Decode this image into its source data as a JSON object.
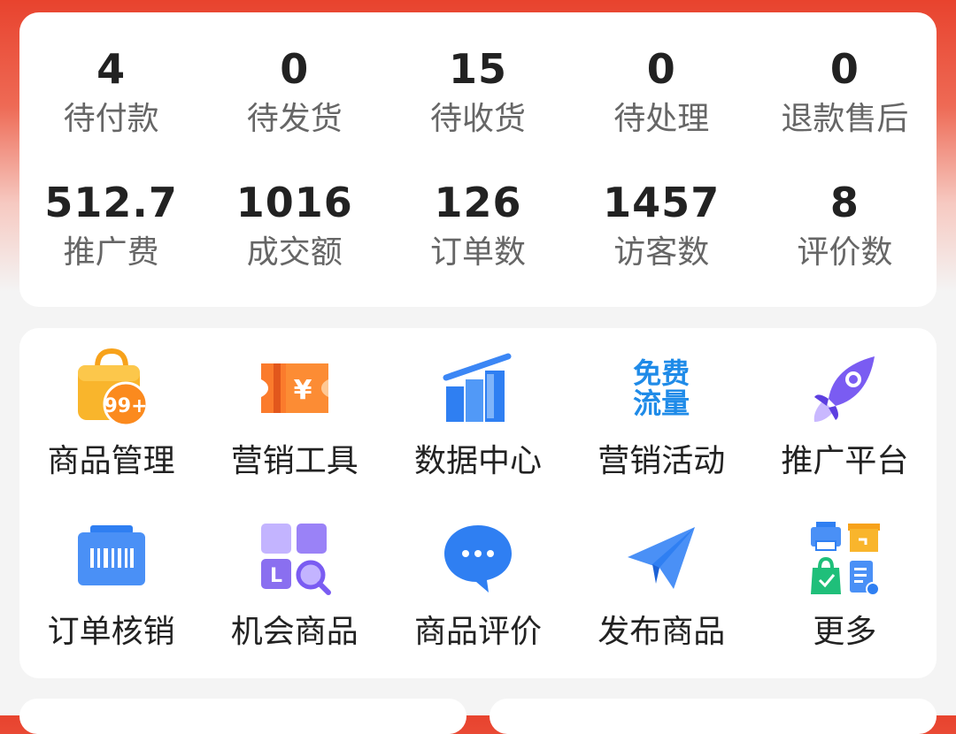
{
  "stats": {
    "row1": [
      {
        "value": "4",
        "label": "待付款"
      },
      {
        "value": "0",
        "label": "待发货"
      },
      {
        "value": "15",
        "label": "待收货"
      },
      {
        "value": "0",
        "label": "待处理"
      },
      {
        "value": "0",
        "label": "退款售后"
      }
    ],
    "row2": [
      {
        "value": "512.7",
        "label": "推广费"
      },
      {
        "value": "1016",
        "label": "成交额"
      },
      {
        "value": "126",
        "label": "订单数"
      },
      {
        "value": "1457",
        "label": "访客数"
      },
      {
        "value": "8",
        "label": "评价数"
      }
    ]
  },
  "tools": [
    {
      "label": "商品管理",
      "icon": "shopping-bag-icon",
      "badge": "99+"
    },
    {
      "label": "营销工具",
      "icon": "coupon-icon",
      "glyph": "¥"
    },
    {
      "label": "数据中心",
      "icon": "bar-chart-icon"
    },
    {
      "label": "营销活动",
      "icon": "free-traffic-icon",
      "icon_text": [
        "免费",
        "流量"
      ]
    },
    {
      "label": "推广平台",
      "icon": "rocket-icon"
    },
    {
      "label": "订单核销",
      "icon": "barcode-scanner-icon"
    },
    {
      "label": "机会商品",
      "icon": "opportunity-search-icon",
      "glyph": "L"
    },
    {
      "label": "商品评价",
      "icon": "chat-bubble-icon"
    },
    {
      "label": "发布商品",
      "icon": "paper-plane-icon"
    },
    {
      "label": "更多",
      "icon": "more-apps-icon"
    }
  ],
  "colors": {
    "header_red": "#e8432e",
    "orange": "#f7a21b",
    "blue": "#2f7ff2",
    "purple": "#7a5cf2",
    "green": "#1fbf7a"
  }
}
